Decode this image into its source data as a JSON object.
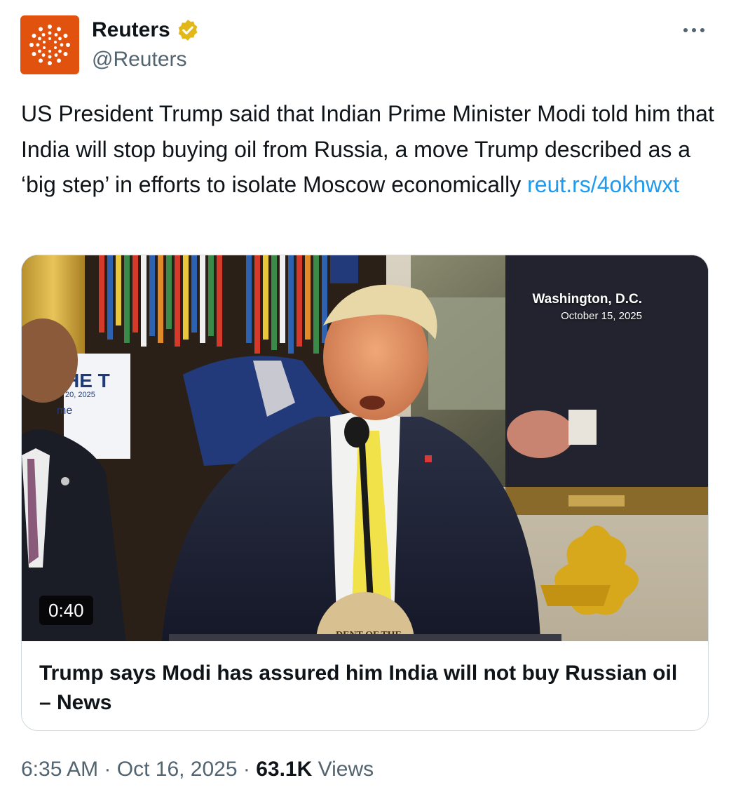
{
  "author": {
    "name": "Reuters",
    "handle": "@Reuters",
    "verified": true,
    "avatar_color": "#e2520f",
    "verified_color": "#e2b719"
  },
  "tweet": {
    "text": "US President Trump said that Indian Prime Minister Modi told him that India will stop buying oil from Russia, a move Trump described as a ‘big step’ in efforts to isolate Moscow economically",
    "link": "reut.rs/4okhwxt",
    "link_color": "#1d9bf0"
  },
  "card": {
    "location": "Washington, D.C.",
    "date": "October 15, 2025",
    "duration": "0:40",
    "title": "Trump says Modi has assured him India will not buy Russian oil – News",
    "backdrop_lettering": "HE T",
    "backdrop_date": "20, 2025",
    "backdrop_sub": "me",
    "seal_text": "DENT OF THE"
  },
  "meta": {
    "time": "6:35 AM",
    "separator": " · ",
    "date": "Oct 16, 2025",
    "views_count": "63.1K",
    "views_label": "Views"
  },
  "icons": {
    "avatar": "reuters-logo-icon",
    "verified": "verified-badge-icon",
    "more": "more-options-icon"
  }
}
